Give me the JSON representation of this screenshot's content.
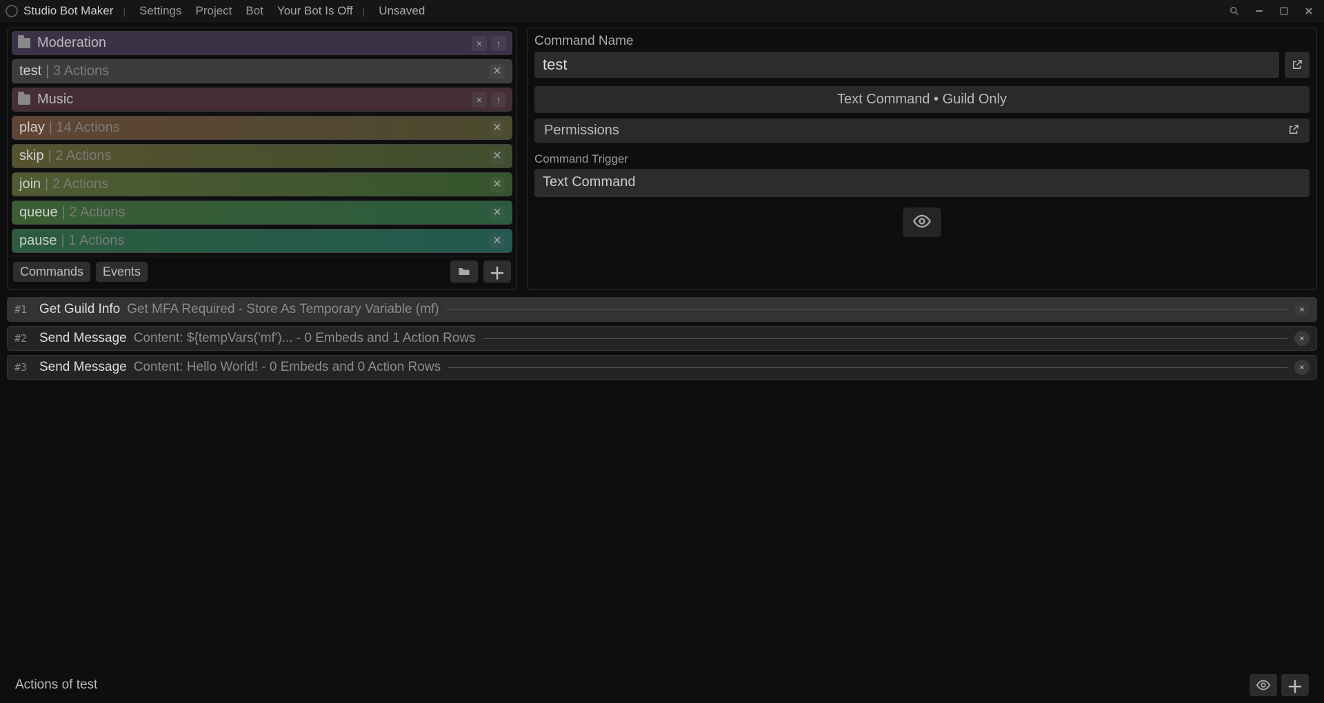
{
  "titlebar": {
    "app_name": "Studio Bot Maker",
    "menu": {
      "settings": "Settings",
      "project": "Project",
      "bot": "Bot"
    },
    "status_bot": "Your Bot Is Off",
    "status_save": "Unsaved"
  },
  "sidebar": {
    "folders": [
      {
        "name": "Moderation",
        "style": "folder-moderation"
      },
      {
        "name": "Music",
        "style": "folder-music"
      }
    ],
    "commands": [
      {
        "name": "test",
        "actions": "3 Actions",
        "style": "cmd-test",
        "folder": 0,
        "selected": true
      },
      {
        "name": "play",
        "actions": "14 Actions",
        "style": "cmd-play",
        "folder": 1
      },
      {
        "name": "skip",
        "actions": "2 Actions",
        "style": "cmd-skip",
        "folder": 1
      },
      {
        "name": "join",
        "actions": "2 Actions",
        "style": "cmd-join",
        "folder": 1
      },
      {
        "name": "queue",
        "actions": "2 Actions",
        "style": "cmd-queue",
        "folder": 1
      },
      {
        "name": "pause",
        "actions": "1 Actions",
        "style": "cmd-pause",
        "folder": 1
      }
    ],
    "tabs": {
      "commands": "Commands",
      "events": "Events"
    }
  },
  "editor": {
    "name_label": "Command Name",
    "name_value": "test",
    "type_pill": "Text Command • Guild Only",
    "permissions_label": "Permissions",
    "trigger_label": "Command Trigger",
    "trigger_value": "Text Command"
  },
  "actions": {
    "footer": "Actions of test",
    "items": [
      {
        "idx": "#1",
        "title": "Get Guild Info",
        "detail": "Get MFA Required - Store As Temporary Variable (mf)",
        "selected": true
      },
      {
        "idx": "#2",
        "title": "Send Message",
        "detail": "Content: ${tempVars('mf')... - 0 Embeds and 1 Action Rows"
      },
      {
        "idx": "#3",
        "title": "Send Message",
        "detail": "Content: Hello World! - 0 Embeds and 0 Action Rows"
      }
    ]
  }
}
